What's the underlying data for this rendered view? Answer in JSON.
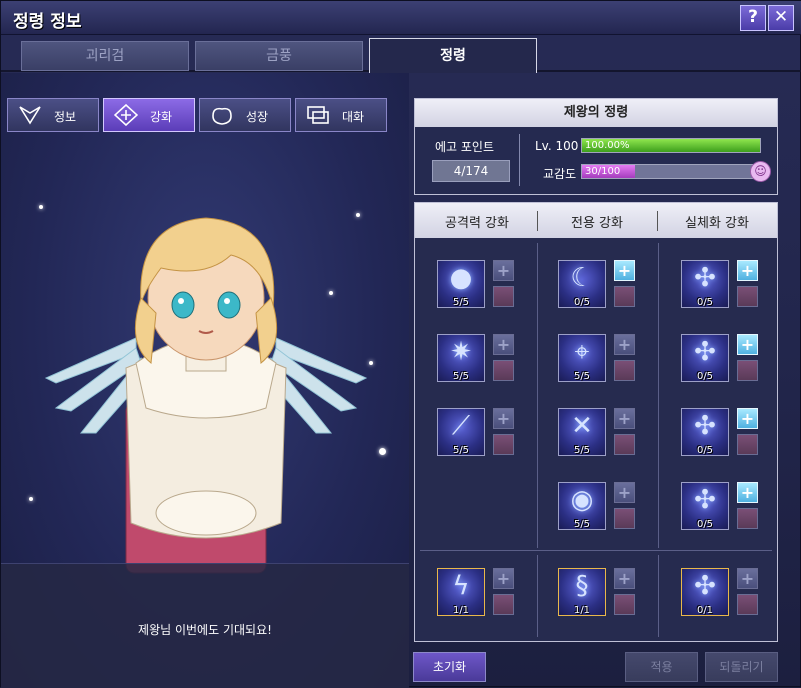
{
  "window": {
    "title": "정령 정보",
    "help_label": "?",
    "close_label": "✕"
  },
  "tabs": [
    {
      "label": "괴리검"
    },
    {
      "label": "금풍"
    },
    {
      "label": "정령"
    }
  ],
  "modes": [
    {
      "label": "정보",
      "icon": "info-icon"
    },
    {
      "label": "강화",
      "icon": "enhance-icon"
    },
    {
      "label": "성장",
      "icon": "growth-icon"
    },
    {
      "label": "대화",
      "icon": "chat-icon"
    }
  ],
  "spirit": {
    "name": "제왕의 정령",
    "ego_label": "에고 포인트",
    "ego_value": "4/174",
    "level_label": "Lv. 100",
    "level_text": "100.00%",
    "level_fraction": 1.0,
    "affinity_label": "교감도",
    "affinity_text": "30/100",
    "affinity_fraction": 0.3
  },
  "speech": "제왕님 이번에도 기대되요!",
  "enhance": {
    "headers": [
      "공격력 강화",
      "전용 강화",
      "실체화 강화"
    ],
    "columns": [
      {
        "skills": [
          {
            "level": "5/5",
            "icon": "blue-orb-icon"
          },
          {
            "level": "5/5",
            "icon": "star-burst-icon"
          },
          {
            "level": "5/5",
            "icon": "sword-slash-icon"
          }
        ],
        "bottom": {
          "level": "1/1",
          "icon": "lightning-orb-icon"
        }
      },
      {
        "skills": [
          {
            "level": "0/5",
            "icon": "crescent-icon"
          },
          {
            "level": "5/5",
            "icon": "target-skull-icon"
          },
          {
            "level": "5/5",
            "icon": "crossed-swords-icon"
          },
          {
            "level": "5/5",
            "icon": "eye-icon"
          }
        ],
        "bottom": {
          "level": "1/1",
          "icon": "dragon-icon"
        }
      },
      {
        "skills": [
          {
            "level": "0/5",
            "icon": "angel-power-icon"
          },
          {
            "level": "0/5",
            "icon": "angel-move-icon"
          },
          {
            "level": "0/5",
            "icon": "angel-time-icon"
          },
          {
            "level": "0/5",
            "icon": "angel-up-icon"
          }
        ],
        "bottom": {
          "level": "0/1",
          "icon": "angel-icon"
        }
      }
    ]
  },
  "buttons": {
    "reset": "초기화",
    "apply": "적용",
    "revert": "되돌리기"
  }
}
